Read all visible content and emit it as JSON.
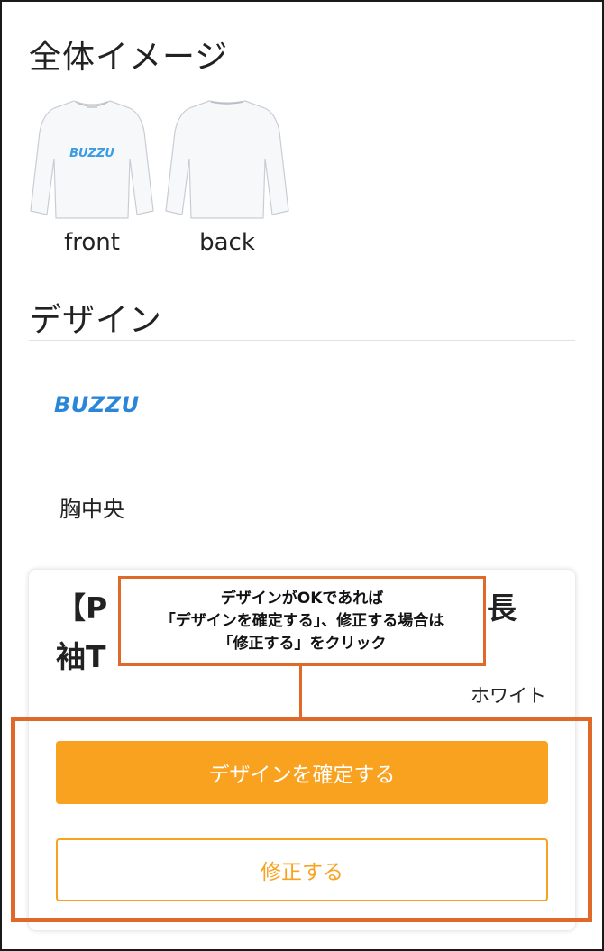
{
  "overview": {
    "title": "全体イメージ",
    "front_label": "front",
    "back_label": "back",
    "shirt_print": "BUZZU"
  },
  "design": {
    "title": "デザイン",
    "logo_text": "BUZZU",
    "placement": "胸中央"
  },
  "product": {
    "title_visible_left": "【P",
    "title_visible_right": "長",
    "title_line2_visible": "袖T",
    "color": "ホワイト"
  },
  "buttons": {
    "confirm_label": "デザインを確定する",
    "edit_label": "修正する"
  },
  "callout": {
    "line1": "デザインがOKであれば",
    "line2": "「デザインを確定する」、修正する場合は",
    "line3": "「修正する」をクリック"
  },
  "colors": {
    "accent": "#f9a21f",
    "highlight": "#e0692a",
    "logo": "#2a86d8"
  }
}
